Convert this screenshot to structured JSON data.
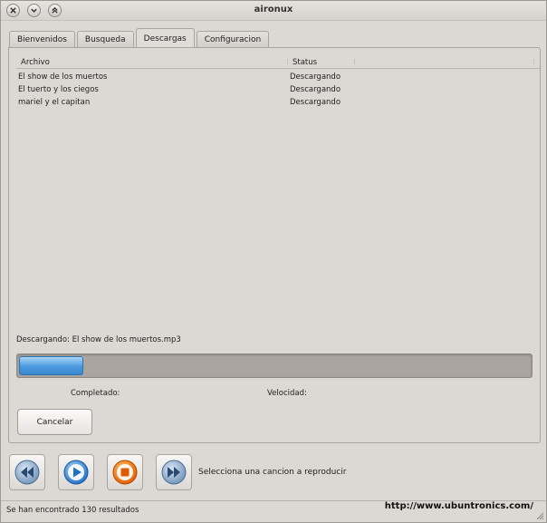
{
  "window": {
    "title": "aironux"
  },
  "tabs": [
    {
      "label": "Bienvenidos"
    },
    {
      "label": "Busqueda"
    },
    {
      "label": "Descargas"
    },
    {
      "label": "Configuracion"
    }
  ],
  "downloads": {
    "columns": {
      "file": "Archivo",
      "status": "Status"
    },
    "rows": [
      {
        "file": "El show de los muertos",
        "status": "Descargando"
      },
      {
        "file": "El tuerto y los ciegos",
        "status": "Descargando"
      },
      {
        "file": "mariel y el capitan",
        "status": "Descargando"
      }
    ],
    "current_label": "Descargando: El show de los muertos.mp3",
    "progress": 0.125,
    "completed_label": "Completado:",
    "speed_label": "Velocidad:",
    "cancel_label": "Cancelar"
  },
  "player": {
    "buttons": [
      {
        "icon": "rewind-icon"
      },
      {
        "icon": "play-icon"
      },
      {
        "icon": "stop-icon"
      },
      {
        "icon": "fast-forward-icon"
      }
    ],
    "now_playing": "Selecciona una cancion a reproducir"
  },
  "statusbar": {
    "message": "Se han encontrado 130 resultados",
    "url": "http://www.ubuntronics.com/"
  },
  "colors": {
    "progress_fill": "#4a9ae0",
    "play_blue": "#2a7cd0",
    "stop_orange": "#e8700a",
    "nav_gray_blue": "#7a9cc0"
  }
}
